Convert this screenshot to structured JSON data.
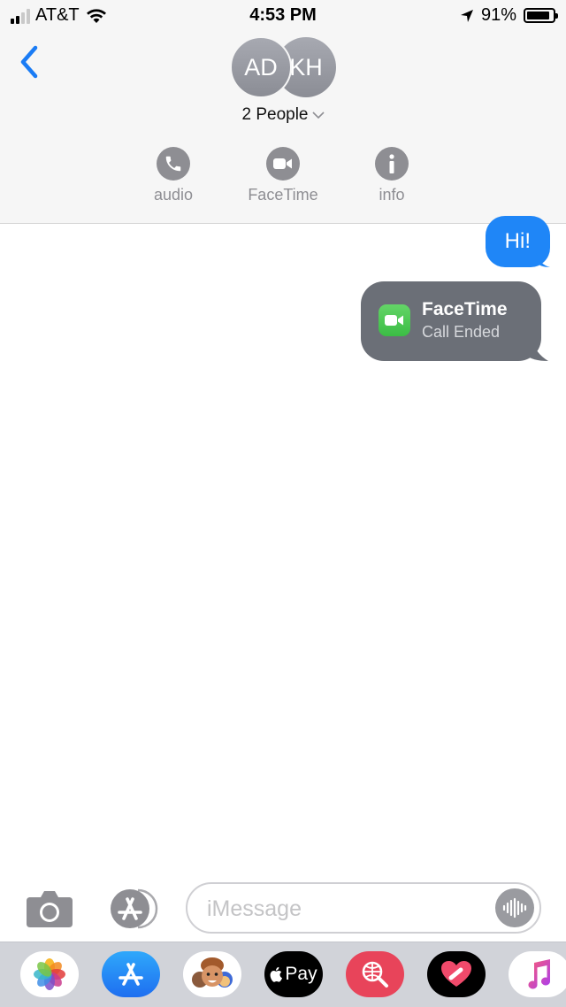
{
  "status_bar": {
    "carrier": "AT&T",
    "time": "4:53 PM",
    "battery_text": "91%",
    "battery_level": 0.91,
    "signal_bars": 2,
    "icons": [
      "signal-icon",
      "wifi-icon",
      "location-arrow-icon",
      "battery-icon"
    ]
  },
  "header": {
    "back_icon": "chevron-left-icon",
    "avatars": [
      {
        "initials": "AD"
      },
      {
        "initials": "KH"
      }
    ],
    "people_label": "2 People",
    "actions": [
      {
        "label": "audio",
        "icon": "phone-icon"
      },
      {
        "label": "FaceTime",
        "icon": "video-camera-icon"
      },
      {
        "label": "info",
        "icon": "info-icon"
      }
    ]
  },
  "messages": [
    {
      "type": "text",
      "direction": "outgoing",
      "text": "Hi!"
    },
    {
      "type": "facetime",
      "direction": "outgoing",
      "title": "FaceTime",
      "subtitle": "Call Ended"
    }
  ],
  "composer": {
    "placeholder": "iMessage",
    "value": "",
    "icons": [
      "camera-icon",
      "app-store-icon",
      "audio-waveform-icon"
    ]
  },
  "app_tray": [
    {
      "name": "photos-app",
      "icon": "photos-icon"
    },
    {
      "name": "app-store-app",
      "icon": "app-store-icon"
    },
    {
      "name": "memoji-app",
      "icon": "memoji-icon"
    },
    {
      "name": "apple-pay-app",
      "label": "Pay",
      "icon": "apple-pay-icon"
    },
    {
      "name": "search-images-app",
      "icon": "globe-search-icon"
    },
    {
      "name": "digital-touch-app",
      "icon": "heart-icon"
    },
    {
      "name": "music-app",
      "icon": "music-note-icon"
    }
  ],
  "colors": {
    "outgoing_bubble": "#1f86f7",
    "facetime_bubble": "#6b6f77",
    "facetime_green": "#3bbd45",
    "ios_blue": "#1a7cf5",
    "action_gray": "#8e8e93"
  }
}
